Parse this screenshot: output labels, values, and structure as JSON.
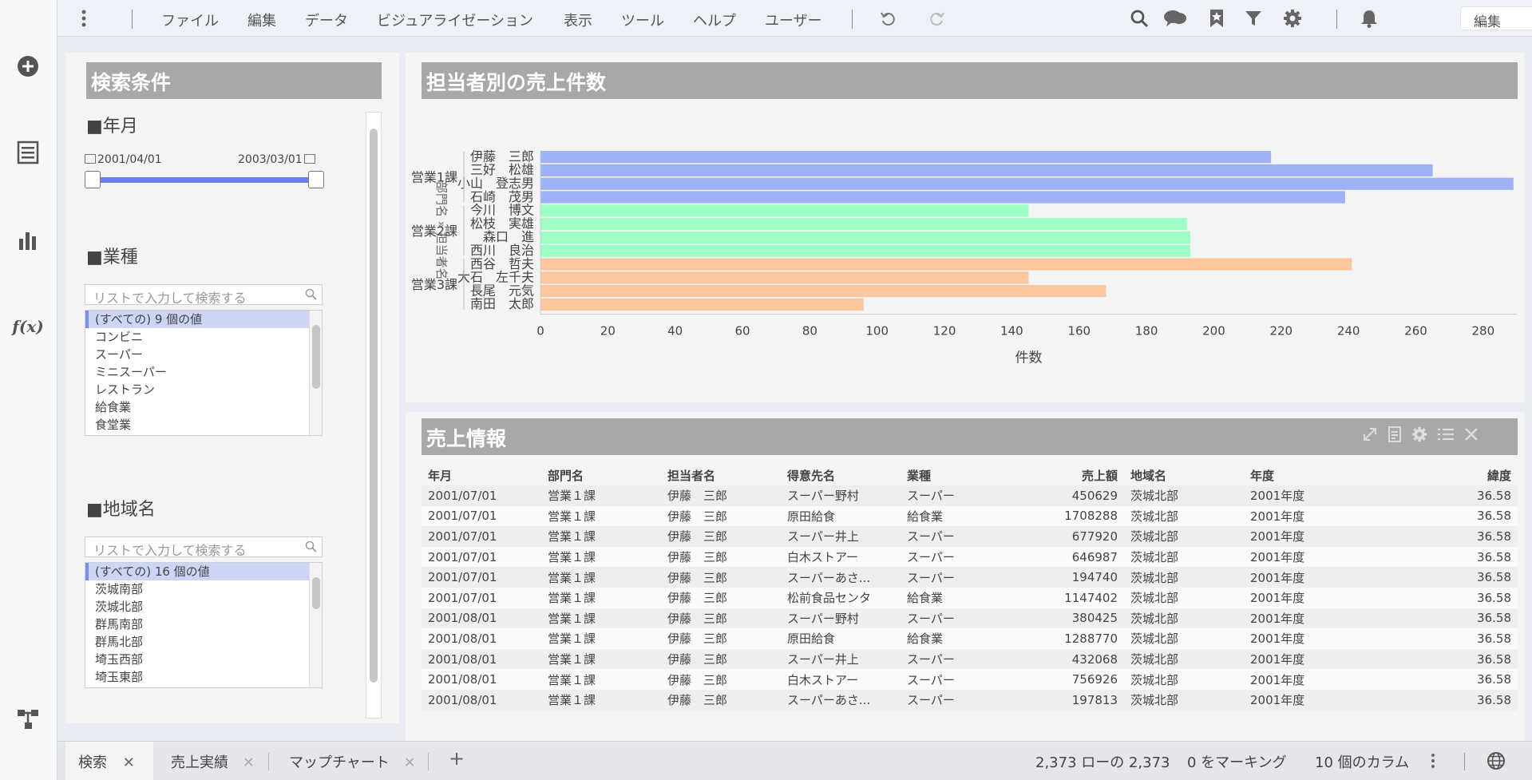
{
  "menu": [
    "ファイル",
    "編集",
    "データ",
    "ビジュアライゼーション",
    "表示",
    "ツール",
    "ヘルプ",
    "ユーザー"
  ],
  "edit_mode": "編集",
  "filter": {
    "title": "検索条件",
    "date_section": "■年月",
    "date_from": "2001/04/01",
    "date_to": "2003/03/01",
    "industry_section": "■業種",
    "industry_placeholder": "リストで入力して検索する",
    "industry_items": [
      "(すべての) 9 個の値",
      "コンビニ",
      "スーパー",
      "ミニスーパー",
      "レストラン",
      "給食業",
      "食堂業"
    ],
    "region_section": "■地域名",
    "region_placeholder": "リストで入力して検索する",
    "region_items": [
      "(すべての) 16 個の値",
      "茨城南部",
      "茨城北部",
      "群馬南部",
      "群馬北部",
      "埼玉西部",
      "埼玉東部"
    ]
  },
  "chart_title": "担当者別の売上件数",
  "chart_data": {
    "type": "bar",
    "orientation": "horizontal",
    "xlabel": "件数",
    "ylabel": "部門名 » 担当者名",
    "xlim": [
      0,
      290
    ],
    "xticks": [
      0,
      20,
      40,
      60,
      80,
      100,
      120,
      140,
      160,
      180,
      200,
      220,
      240,
      260,
      280
    ],
    "groups": [
      {
        "name": "営業1課",
        "color": "#9db2f7",
        "categories": [
          "伊藤　三郎",
          "三好　松雄",
          "小山　登志男",
          "石崎　茂男"
        ],
        "values": [
          217,
          265,
          289,
          239
        ]
      },
      {
        "name": "営業2課",
        "color": "#9effc6",
        "categories": [
          "今川　博文",
          "松枝　実雄",
          "森口　進",
          "西川　良治"
        ],
        "values": [
          145,
          192,
          193,
          193
        ]
      },
      {
        "name": "営業3課",
        "color": "#fbc79d",
        "categories": [
          "西谷　哲夫",
          "大石　左千夫",
          "長尾　元気",
          "南田　太郎"
        ],
        "values": [
          241,
          145,
          168,
          96
        ]
      }
    ]
  },
  "sales_title": "売上情報",
  "table": {
    "columns": [
      "年月",
      "部門名",
      "担当者名",
      "得意先名",
      "業種",
      "売上額",
      "地域名",
      "年度",
      "緯度"
    ],
    "rows": [
      [
        "2001/07/01",
        "営業１課",
        "伊藤　三郎",
        "スーパー野村",
        "スーパー",
        "450629",
        "茨城北部",
        "2001年度",
        "36.58"
      ],
      [
        "2001/07/01",
        "営業１課",
        "伊藤　三郎",
        "原田給食",
        "給食業",
        "1708288",
        "茨城北部",
        "2001年度",
        "36.58"
      ],
      [
        "2001/07/01",
        "営業１課",
        "伊藤　三郎",
        "スーパー井上",
        "スーパー",
        "677920",
        "茨城北部",
        "2001年度",
        "36.58"
      ],
      [
        "2001/07/01",
        "営業１課",
        "伊藤　三郎",
        "白木ストアー",
        "スーパー",
        "646987",
        "茨城北部",
        "2001年度",
        "36.58"
      ],
      [
        "2001/07/01",
        "営業１課",
        "伊藤　三郎",
        "スーパーあさ...",
        "スーパー",
        "194740",
        "茨城北部",
        "2001年度",
        "36.58"
      ],
      [
        "2001/07/01",
        "営業１課",
        "伊藤　三郎",
        "松前食品センタ",
        "給食業",
        "1147402",
        "茨城北部",
        "2001年度",
        "36.58"
      ],
      [
        "2001/08/01",
        "営業１課",
        "伊藤　三郎",
        "スーパー野村",
        "スーパー",
        "380425",
        "茨城北部",
        "2001年度",
        "36.58"
      ],
      [
        "2001/08/01",
        "営業１課",
        "伊藤　三郎",
        "原田給食",
        "給食業",
        "1288770",
        "茨城北部",
        "2001年度",
        "36.58"
      ],
      [
        "2001/08/01",
        "営業１課",
        "伊藤　三郎",
        "スーパー井上",
        "スーパー",
        "432068",
        "茨城北部",
        "2001年度",
        "36.58"
      ],
      [
        "2001/08/01",
        "営業１課",
        "伊藤　三郎",
        "白木ストアー",
        "スーパー",
        "756926",
        "茨城北部",
        "2001年度",
        "36.58"
      ],
      [
        "2001/08/01",
        "営業１課",
        "伊藤　三郎",
        "スーパーあさ...",
        "スーパー",
        "197813",
        "茨城北部",
        "2001年度",
        "36.58"
      ]
    ]
  },
  "tabs": [
    "検索",
    "売上実績",
    "マップチャート"
  ],
  "status": {
    "rows": "2,373 ローの 2,373",
    "marking": "0 をマーキング",
    "columns": "10 個のカラム"
  }
}
